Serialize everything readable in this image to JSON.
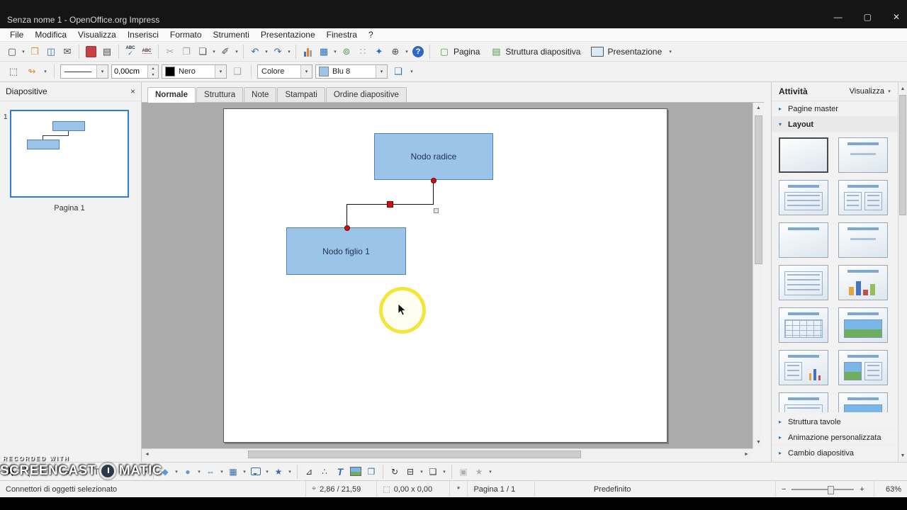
{
  "window": {
    "title": "Senza nome 1 - OpenOffice.org Impress",
    "minimize": "—",
    "maximize": "▢",
    "close": "✕"
  },
  "menu": {
    "items": [
      "File",
      "Modifica",
      "Visualizza",
      "Inserisci",
      "Formato",
      "Strumenti",
      "Presentazione",
      "Finestra",
      "?"
    ]
  },
  "toolbar": {
    "pagina_label": "Pagina",
    "struttura_label": "Struttura diapositiva",
    "presentazione_label": "Presentazione"
  },
  "format_bar": {
    "line_width": "0,00cm",
    "line_color": "Nero",
    "fill_type": "Colore",
    "fill_color": "Blu 8"
  },
  "slides_panel": {
    "title": "Diapositive",
    "slide_number": "1",
    "page_label": "Pagina 1"
  },
  "tabs": {
    "items": [
      "Normale",
      "Struttura",
      "Note",
      "Stampati",
      "Ordine diapositive"
    ]
  },
  "canvas": {
    "root_node": "Nodo radice",
    "child_node": "Nodo figlio 1"
  },
  "tasks": {
    "title": "Attività",
    "view_label": "Visualizza",
    "section_master": "Pagine master",
    "section_layout": "Layout",
    "section_tables": "Struttura tavole",
    "section_animation": "Animazione personalizzata",
    "section_transition": "Cambio diapositiva"
  },
  "status": {
    "message": "Connettori di oggetti selezionato",
    "position": "2,86 / 21,59",
    "size": "0,00 x 0,00",
    "modified": "*",
    "page": "Pagina 1 / 1",
    "style": "Predefinito",
    "zoom": "63%"
  },
  "watermark": {
    "top": "RECORDED WITH",
    "brand_left": "SCREENCAST",
    "brand_right": "MATIC"
  },
  "icons": {
    "dropdown": "▾",
    "tri_right": "▸",
    "tri_down": "▾",
    "close": "×",
    "new_doc": "▢",
    "open": "❒",
    "save": "◫",
    "email": "✉",
    "edit": "✎",
    "print": "▤",
    "spell_text": "ABC",
    "spell_check": "✓",
    "cut": "✂",
    "copy": "❐",
    "paste": "❏",
    "brush": "✐",
    "undo": "↶",
    "redo": "↷",
    "table": "▦",
    "hyperlink": "⊚",
    "grid": "∷",
    "navigator": "✦",
    "zoom": "⊕",
    "help": "?",
    "page_icon": "▢",
    "outline_icon": "▤",
    "play_icon": "▶",
    "points": "⬚",
    "arrowheads": "↬",
    "shadow": "❑",
    "up": "▴",
    "down": "▾",
    "scroll_up": "▲",
    "scroll_down": "▼",
    "scroll_left": "◄",
    "scroll_right": "►",
    "line": "╲",
    "arrow": "→",
    "rect": "▭",
    "ellipse": "○",
    "text": "T",
    "curve": "⌒",
    "connector": "⌐",
    "diamond": "◆",
    "circle": "●",
    "block_arrow": "⇔",
    "flowchart": "▦",
    "star": "★",
    "edit_points": "⊿",
    "glue_points": "∴",
    "rotate": "↻",
    "align": "⊟",
    "arrange": "❏",
    "extrusion": "▣",
    "position_icon": "⌖",
    "size_icon": "⬚",
    "minus": "−",
    "plus": "+"
  }
}
